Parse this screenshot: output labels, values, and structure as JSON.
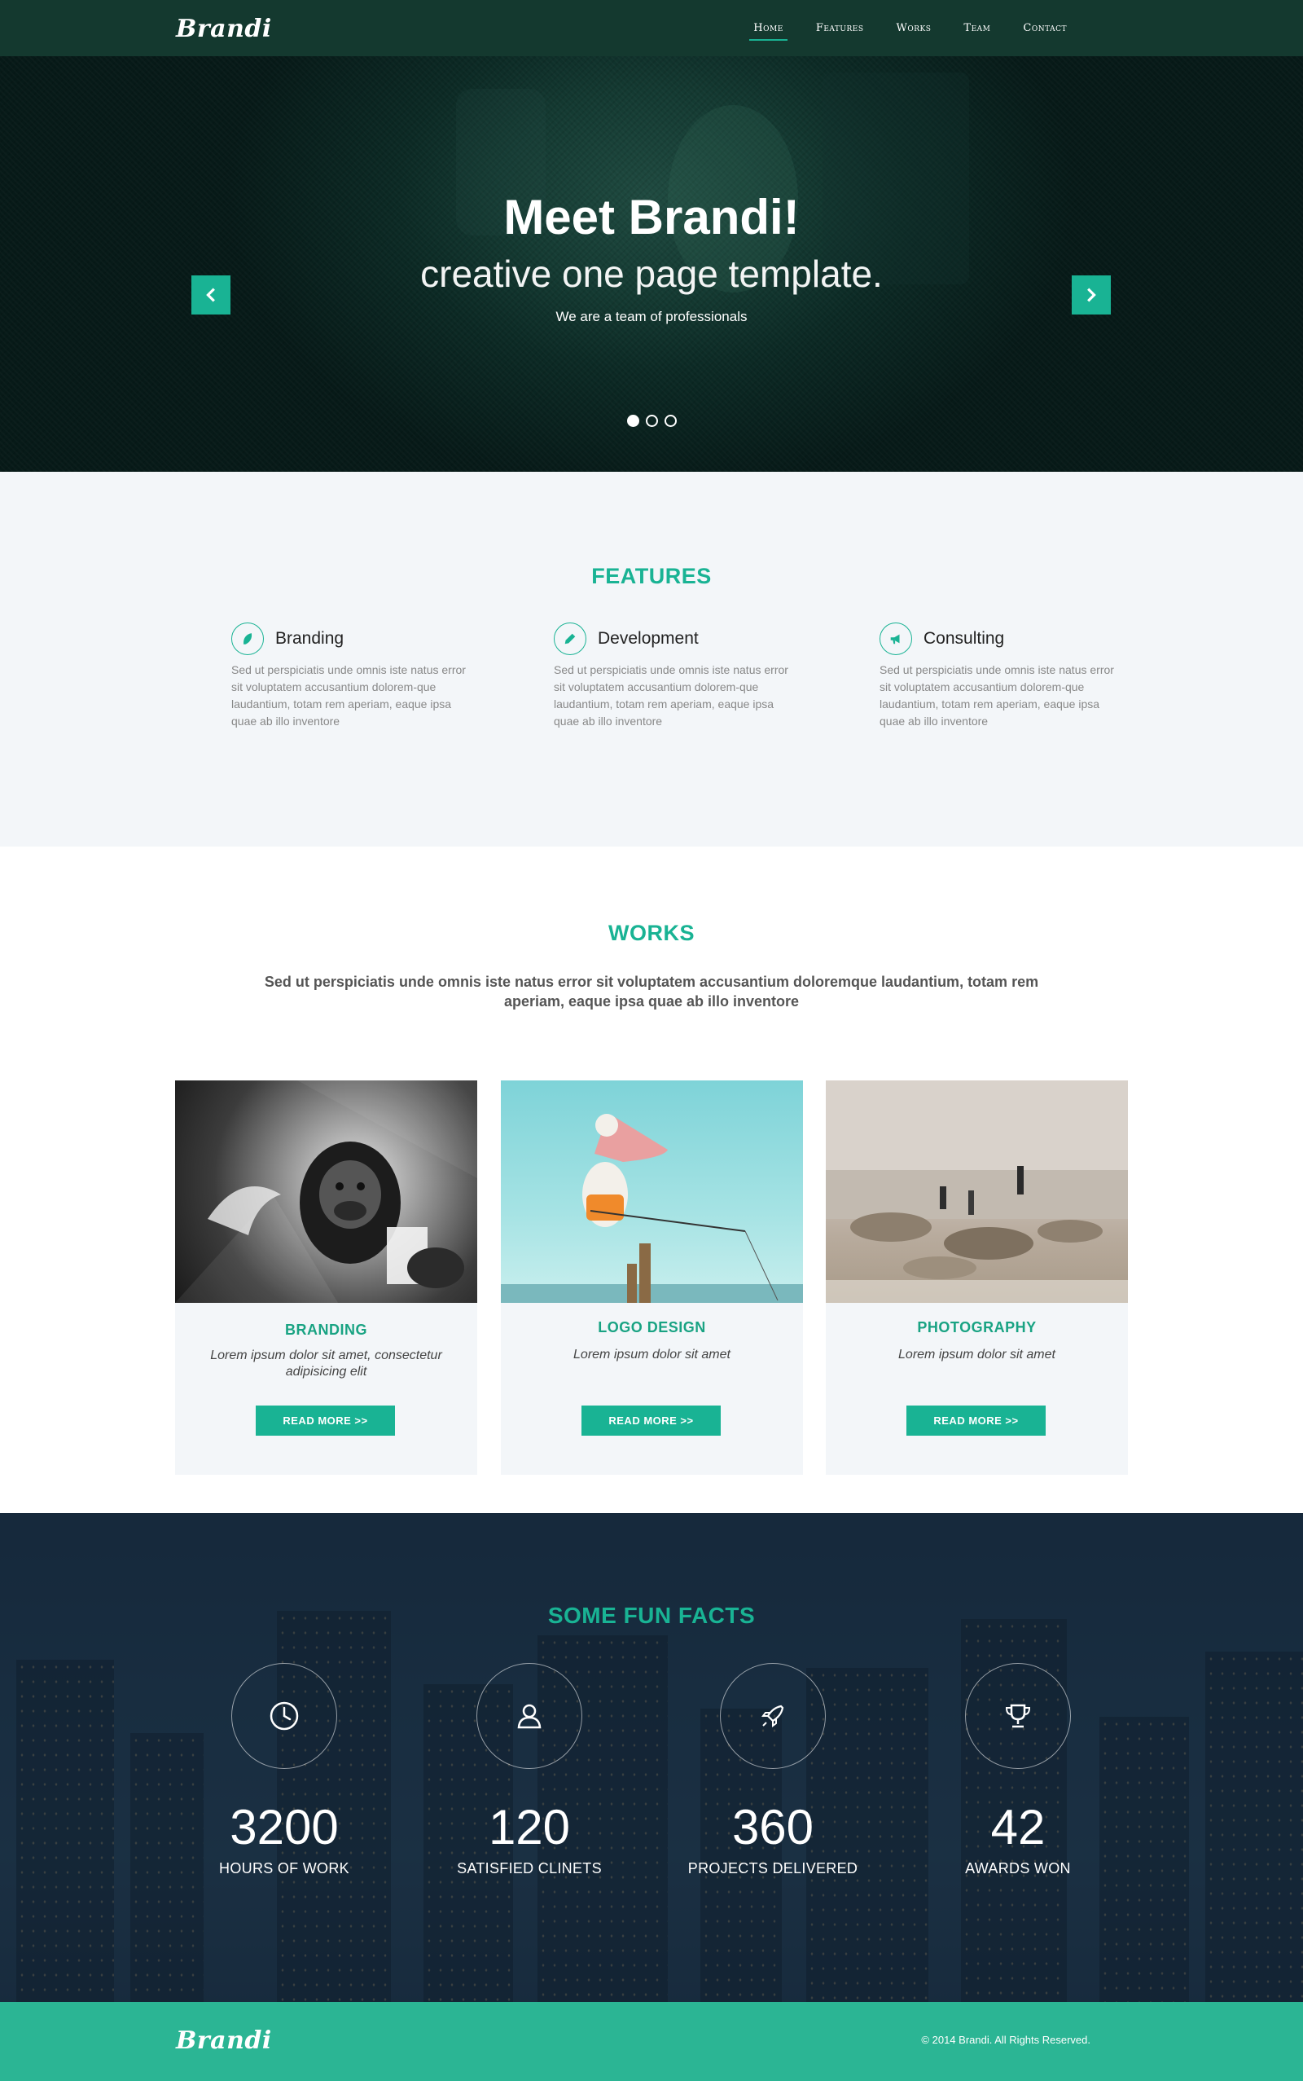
{
  "brand": {
    "logo_text": "Brandi"
  },
  "nav": {
    "items": [
      {
        "label": "Home",
        "active": true
      },
      {
        "label": "Features",
        "active": false
      },
      {
        "label": "Works",
        "active": false
      },
      {
        "label": "Team",
        "active": false
      },
      {
        "label": "Contact",
        "active": false
      }
    ]
  },
  "hero": {
    "title": "Meet Brandi!",
    "subtitle": "creative one page template.",
    "tagline": "We are a team of professionals",
    "slides_total": 3,
    "active_slide": 1,
    "prev_icon": "chevron-left-icon",
    "next_icon": "chevron-right-icon"
  },
  "features": {
    "title": "FEATURES",
    "items": [
      {
        "name": "Branding",
        "icon": "feather-icon",
        "text": "Sed ut perspiciatis unde omnis iste natus error sit voluptatem accusantium dolorem-que laudantium, totam rem aperiam, eaque ipsa quae ab illo inventore"
      },
      {
        "name": "Development",
        "icon": "pencil-icon",
        "text": "Sed ut perspiciatis unde omnis iste natus error sit voluptatem accusantium dolorem-que laudantium, totam rem aperiam, eaque ipsa quae ab illo inventore"
      },
      {
        "name": "Consulting",
        "icon": "megaphone-icon",
        "text": "Sed ut perspiciatis unde omnis iste natus error sit voluptatem accusantium dolorem-que laudantium, totam rem aperiam, eaque ipsa quae ab illo inventore"
      }
    ]
  },
  "works": {
    "title": "WORKS",
    "intro": "Sed ut perspiciatis unde omnis iste natus error sit voluptatem accusantium doloremque laudantium, totam rem aperiam, eaque ipsa quae ab illo inventore",
    "cards": [
      {
        "title": "BRANDING",
        "description": "Lorem ipsum dolor sit amet, consectetur adipisicing elit",
        "button": "READ MORE  >>",
        "image": "gorilla-artwork"
      },
      {
        "title": "LOGO DESIGN",
        "description": "Lorem ipsum dolor sit amet",
        "button": "READ MORE  >>",
        "image": "pelican-fishing"
      },
      {
        "title": "PHOTOGRAPHY",
        "description": "Lorem ipsum dolor sit amet",
        "button": "READ MORE  >>",
        "image": "rocky-shore"
      }
    ]
  },
  "facts": {
    "title": "SOME FUN FACTS",
    "items": [
      {
        "number": "3200",
        "label": "HOURS OF WORK",
        "icon": "clock-icon"
      },
      {
        "number": "120",
        "label": "SATISFIED CLINETS",
        "icon": "user-icon"
      },
      {
        "number": "360",
        "label": "PROJECTS DELIVERED",
        "icon": "rocket-icon"
      },
      {
        "number": "42",
        "label": "AWARDS WON",
        "icon": "trophy-icon"
      }
    ]
  },
  "footer": {
    "logo_text": "Brandi",
    "copyright": "© 2014 Brandi. All Rights Reserved."
  },
  "colors": {
    "accent": "#19b394",
    "header_bg": "#14392f",
    "footer_bg": "#2bb594",
    "section_bg": "#f3f6f9"
  }
}
